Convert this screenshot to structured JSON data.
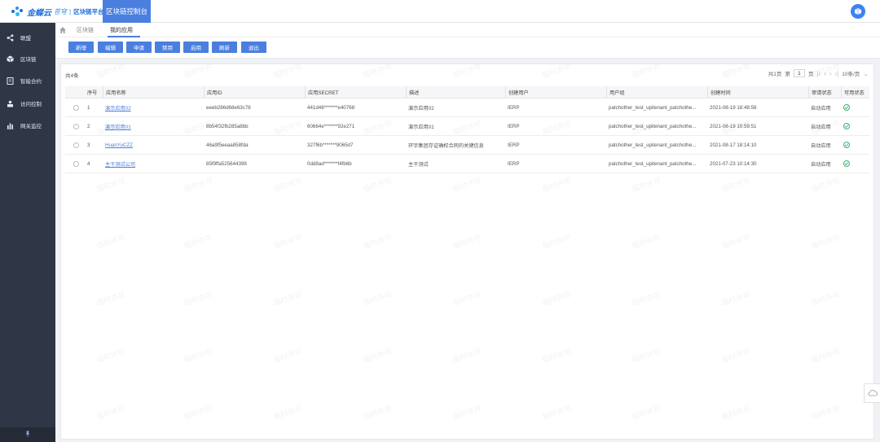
{
  "header": {
    "brand": "金蝶云",
    "brand_sub": "苍穹",
    "separator": "|",
    "platform": "区块链平台",
    "active_tab": "区块链控制台",
    "avatar_icon": "cube-icon",
    "accent": "#4a7fe0"
  },
  "sidebar": {
    "items": [
      {
        "label": "联盟",
        "icon": "share-icon"
      },
      {
        "label": "区块链",
        "icon": "cube-icon"
      },
      {
        "label": "智能合约",
        "icon": "document-icon"
      },
      {
        "label": "访问控制",
        "icon": "user-lock-icon"
      },
      {
        "label": "网关监控",
        "icon": "bar-chart-icon"
      }
    ],
    "bottom_icon": "pin-icon"
  },
  "breadcrumb": {
    "items": [
      "区块链",
      "我的应用"
    ]
  },
  "toolbar": {
    "buttons": [
      "新增",
      "编辑",
      "申请",
      "禁用",
      "启用",
      "刷新",
      "退出"
    ]
  },
  "table_meta": {
    "total": "共4条",
    "pager_prefix": "共1页",
    "pager_page_label": "第",
    "pager_page": "1",
    "pager_suffix": "页",
    "page_size": "10条/页"
  },
  "table": {
    "columns": [
      "",
      "序号",
      "应用名称",
      "应用ID",
      "应用SECRET",
      "描述",
      "创建用户",
      "用户组",
      "创建时间",
      "审请状态",
      "可用状态"
    ],
    "rows": [
      {
        "idx": "1",
        "name": "演示应用02",
        "id": "eeeb286d68e63c78",
        "secret": "441d46*******e40768",
        "desc": "演示应用02",
        "user": "IERP",
        "group": "patchother_test_upitenant_patchothe...",
        "time": "2021-08-19 18:48:58",
        "apply": "自动应用"
      },
      {
        "idx": "2",
        "name": "演示应用01",
        "id": "8b54f32fb285a8bb",
        "secret": "60664e*******92e271",
        "desc": "演示应用01",
        "user": "IERP",
        "group": "patchother_test_upitenant_patchothe...",
        "time": "2021-08-19 10:59:51",
        "apply": "自动应用"
      },
      {
        "idx": "3",
        "name": "HuanYuCZZ",
        "id": "46a9f5eeaa858fda",
        "secret": "327f6b*******9065d7",
        "desc": "环宇集团存证确权合同的关键信息",
        "user": "IERP",
        "group": "patchother_test_upitenant_patchothe...",
        "time": "2021-08-17 18:14:10",
        "apply": "自动应用"
      },
      {
        "idx": "4",
        "name": "主干测试公司",
        "id": "85f9ffa525644398",
        "secret": "0dd8ad*******f4fb6b",
        "desc": "主干测试",
        "user": "IERP",
        "group": "patchother_test_upitenant_patchothe...",
        "time": "2021-07-23 10:14:30",
        "apply": "自动应用"
      }
    ]
  },
  "watermark": "临时许可"
}
